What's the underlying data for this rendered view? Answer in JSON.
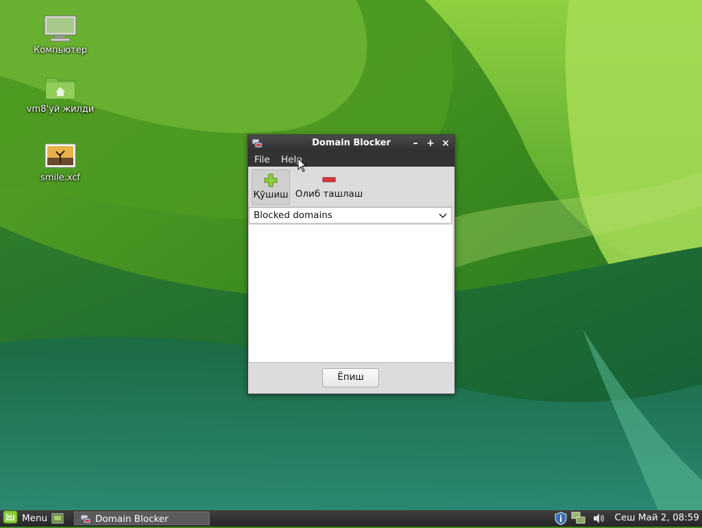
{
  "desktop": {
    "icons": [
      {
        "label": "Компьютер"
      },
      {
        "label": "vm8'уй жилди"
      },
      {
        "label": "smile.xcf"
      }
    ]
  },
  "window": {
    "title": "Domain Blocker",
    "controls": {
      "minimize": "–",
      "maximize": "+",
      "close": "×"
    },
    "menu": {
      "file": "File",
      "help": "Help"
    },
    "toolbar": {
      "add": "Қўшиш",
      "remove": "Олиб ташлаш"
    },
    "combo": {
      "selected": "Blocked domains"
    },
    "close_button": "Ёпиш"
  },
  "taskbar": {
    "menu_label": "Menu",
    "task_label": "Domain Blocker",
    "clock": "Сеш Май  2, 08:59"
  },
  "colors": {
    "accent_green": "#7cc63a",
    "remove_red": "#d9303a",
    "titlebar": "#3a3a3a"
  }
}
